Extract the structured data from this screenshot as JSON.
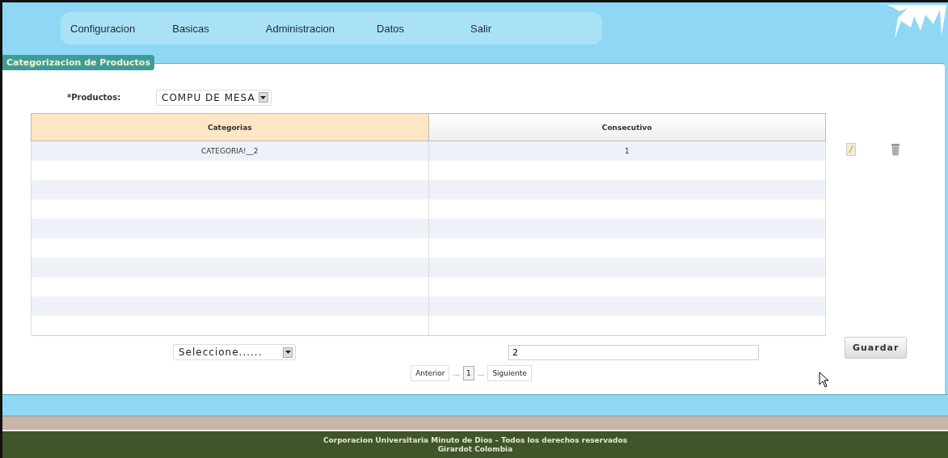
{
  "menu": [
    {
      "label": "Configuracion"
    },
    {
      "label": "Basicas"
    },
    {
      "label": "Administracion"
    },
    {
      "label": "Datos"
    },
    {
      "label": "Salir"
    }
  ],
  "panel": {
    "title": "Categorizacion de Productos"
  },
  "product_field": {
    "label": "*Productos:",
    "value": "COMPU DE MESA"
  },
  "table": {
    "columns": [
      "Categorias",
      "Consecutivo"
    ],
    "rows": [
      {
        "cells": [
          "CATEGORIA!__2",
          "1"
        ],
        "selected": true
      }
    ]
  },
  "category_select": {
    "value": "Seleccione......"
  },
  "consecutive_input": {
    "value": "2"
  },
  "save_button": "Guardar",
  "pagination": {
    "previous": "Anterior",
    "pages": [
      {
        "kind": "ellipsis",
        "label": "..."
      },
      {
        "kind": "page",
        "label": "1",
        "selected": true
      },
      {
        "kind": "ellipsis",
        "label": "..."
      }
    ],
    "next": "Siguiente"
  },
  "footer": {
    "lines": [
      "Corporacion Universitaria Minuto de Dios – Todos los derechos reservados",
      "Girardot Colombia"
    ]
  }
}
